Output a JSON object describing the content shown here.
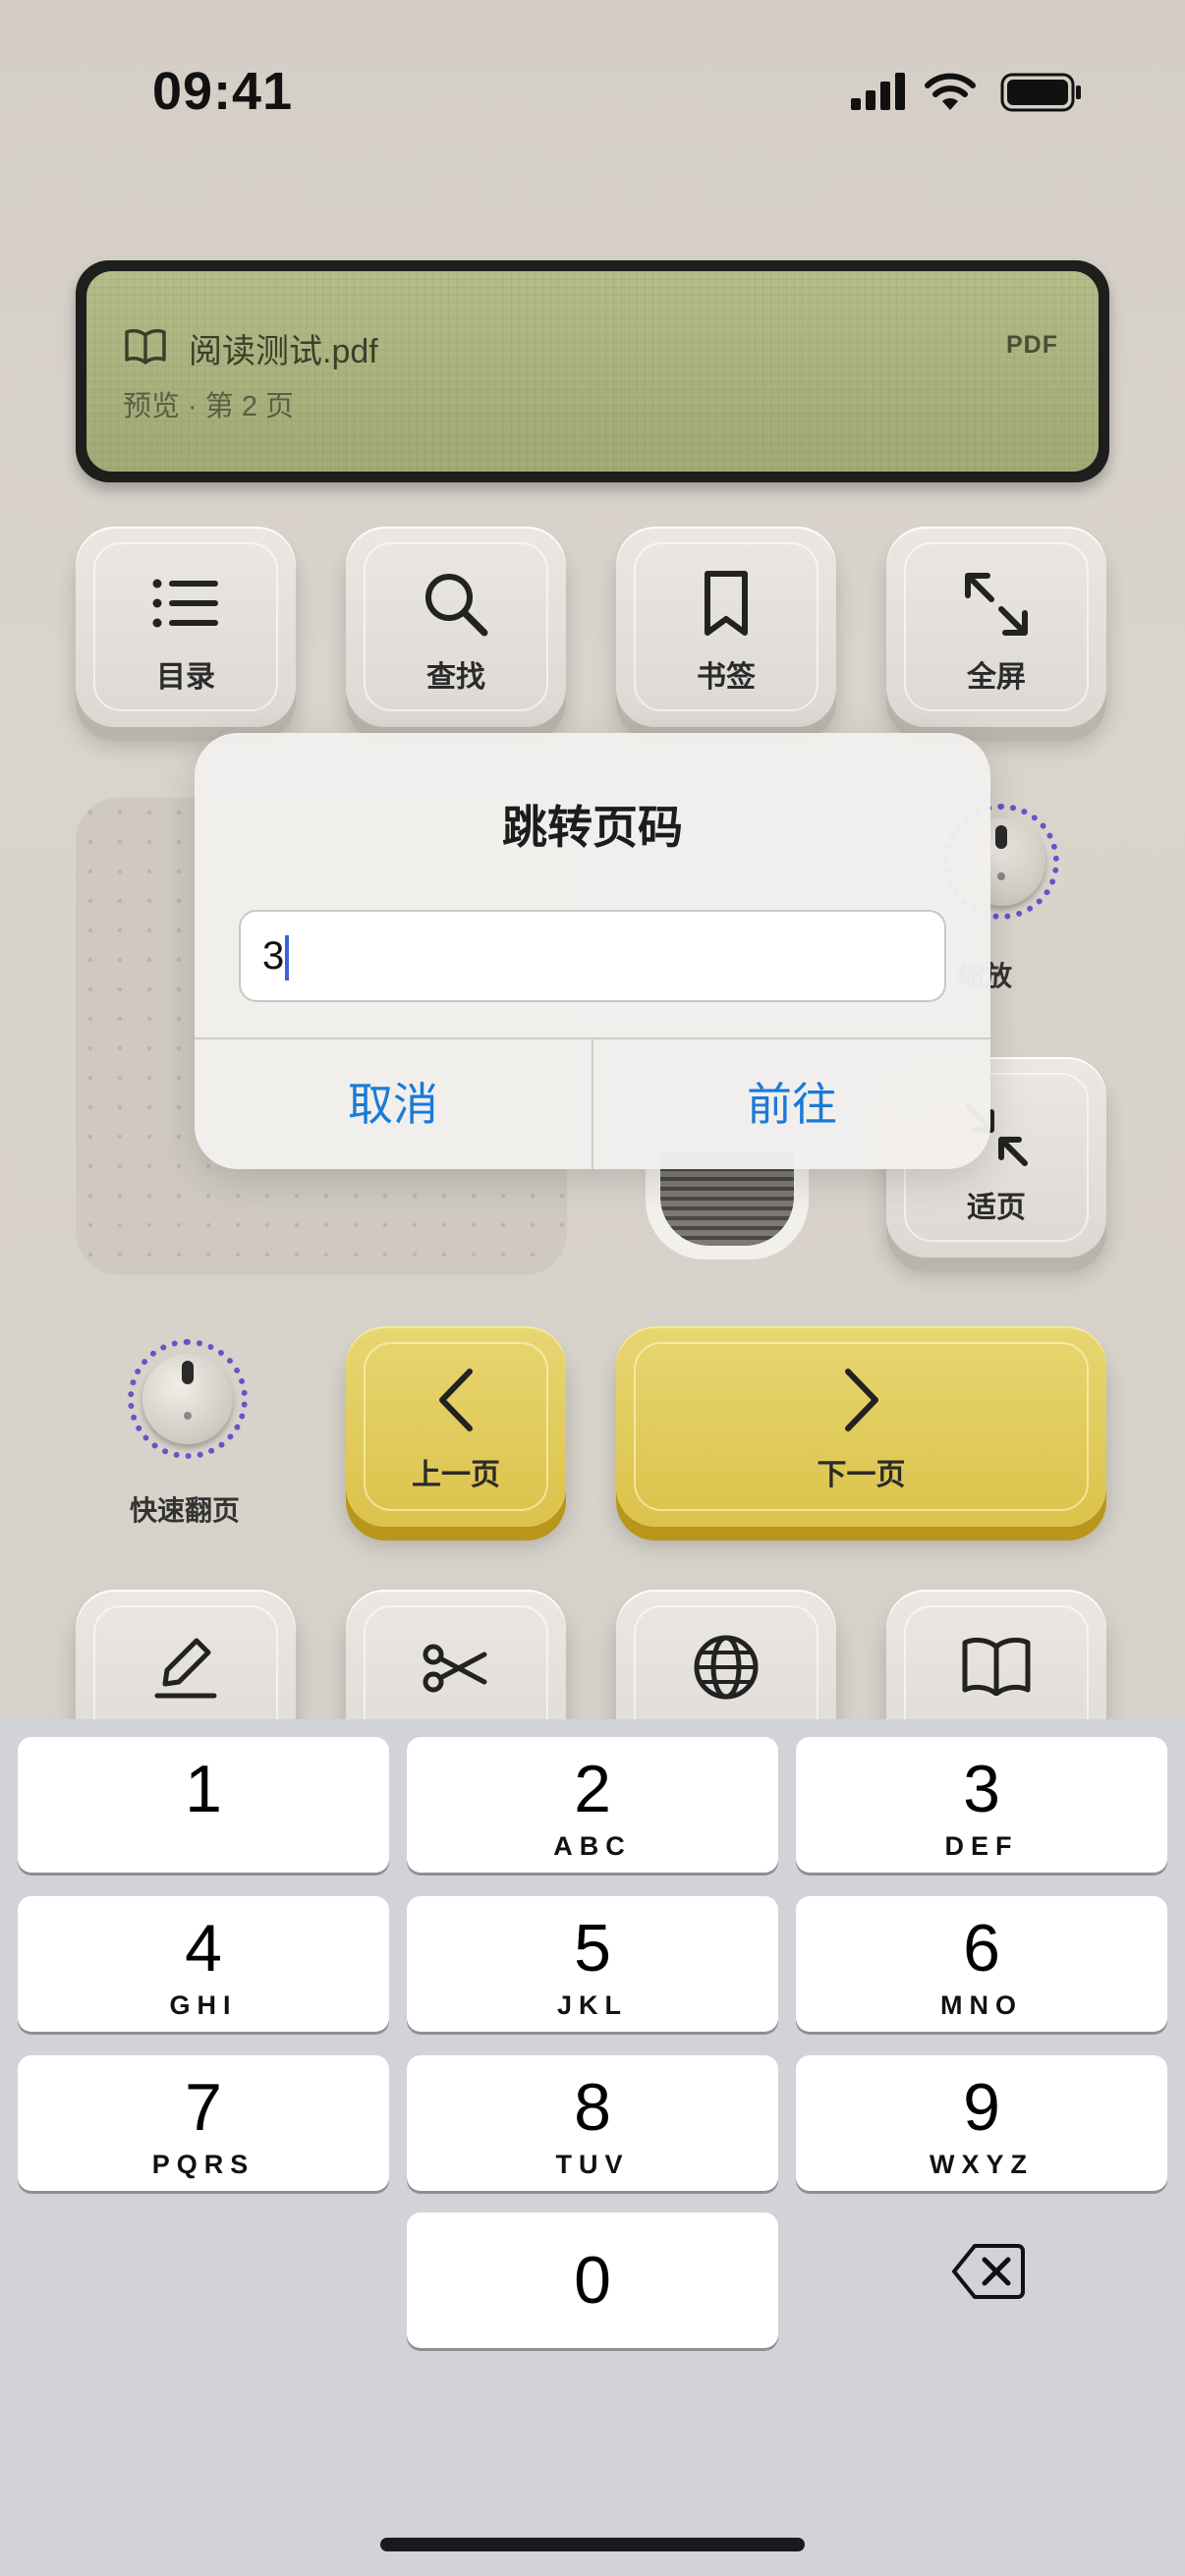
{
  "status_bar": {
    "time": "09:41"
  },
  "lcd": {
    "file_name": "阅读测试.pdf",
    "subtitle": "预览 · 第 2 页",
    "badge": "PDF"
  },
  "controls": {
    "row1": [
      {
        "label": "目录",
        "icon": "list-icon"
      },
      {
        "label": "查找",
        "icon": "search-icon"
      },
      {
        "label": "书签",
        "icon": "bookmark-icon"
      },
      {
        "label": "全屏",
        "icon": "expand-icon"
      }
    ],
    "zoom_knob_label_partial": "缩放",
    "fit_page_label": "适页",
    "fast_flip_label": "快速翻页",
    "prev_page_label": "上一页",
    "next_page_label": "下一页",
    "row4_icons": [
      "pencil-icon",
      "scissors-icon",
      "globe-icon",
      "book-icon"
    ]
  },
  "dialog": {
    "title": "跳转页码",
    "input_value": "3",
    "cancel_label": "取消",
    "go_label": "前往"
  },
  "keypad": [
    {
      "num": "1",
      "letters": ""
    },
    {
      "num": "2",
      "letters": "ABC"
    },
    {
      "num": "3",
      "letters": "DEF"
    },
    {
      "num": "4",
      "letters": "GHI"
    },
    {
      "num": "5",
      "letters": "JKL"
    },
    {
      "num": "6",
      "letters": "MNO"
    },
    {
      "num": "7",
      "letters": "PQRS"
    },
    {
      "num": "8",
      "letters": "TUV"
    },
    {
      "num": "9",
      "letters": "WXYZ"
    },
    {
      "num": "0",
      "letters": ""
    }
  ],
  "colors": {
    "accent_blue": "#1a7ad8",
    "knob_ring": "#6a52c8",
    "yellow_key": "#dcc24a",
    "lcd": "#aab27e"
  }
}
